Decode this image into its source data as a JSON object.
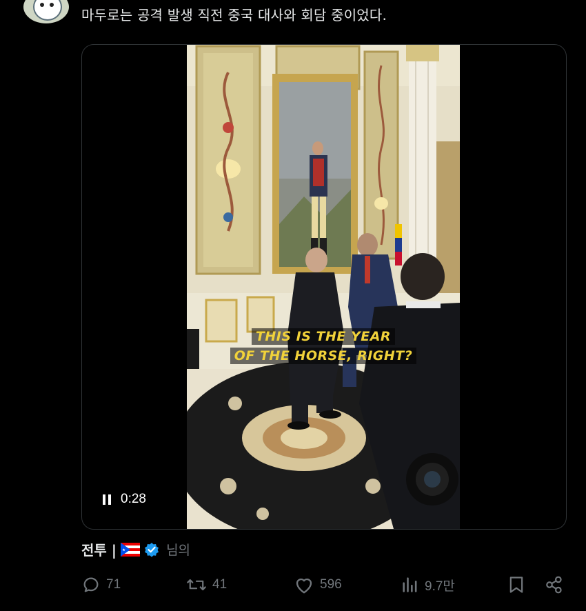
{
  "tweet": {
    "text": "마두로는 공격 발생 직전 중국 대사와 회담 중이었다."
  },
  "video": {
    "subtitle_line1": "THIS IS THE YEAR",
    "subtitle_line2": "OF THE HORSE, RIGHT?",
    "time": "0:28",
    "state_icon": "pause-icon"
  },
  "quoted": {
    "name": "전투 |",
    "flag_icon": "puerto-rico-flag-icon",
    "verified_icon": "verified-badge-icon",
    "suffix": "님의"
  },
  "actions": {
    "replies": "71",
    "reposts": "41",
    "likes": "596",
    "views": "9.7만"
  },
  "colors": {
    "background": "#000000",
    "text": "#e7e9ea",
    "muted": "#71767b",
    "verified": "#1d9bf0",
    "subtitle": "#f1d23a"
  }
}
